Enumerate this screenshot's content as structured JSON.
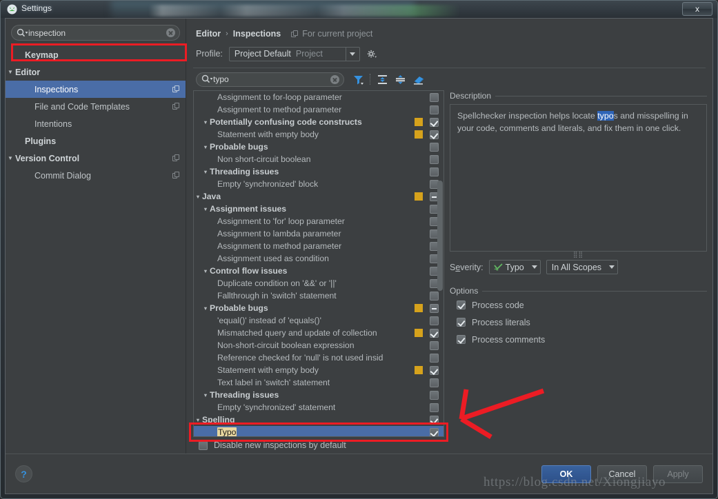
{
  "window": {
    "title": "Settings",
    "app_icon": "android-studio-icon",
    "close_label": "x"
  },
  "sidebar": {
    "search": {
      "value": "inspection",
      "icon": "search-icon",
      "clear_icon": "clear-icon"
    },
    "items": [
      {
        "label": "Keymap",
        "indent": 1,
        "bold": true,
        "arrow": "",
        "selected": false,
        "copy_icon": false
      },
      {
        "label": "Editor",
        "indent": 0,
        "bold": true,
        "arrow": "▼",
        "selected": false,
        "copy_icon": false
      },
      {
        "label": "Inspections",
        "indent": 2,
        "bold": false,
        "arrow": "",
        "selected": true,
        "copy_icon": true
      },
      {
        "label": "File and Code Templates",
        "indent": 2,
        "bold": false,
        "arrow": "",
        "selected": false,
        "copy_icon": true
      },
      {
        "label": "Intentions",
        "indent": 2,
        "bold": false,
        "arrow": "",
        "selected": false,
        "copy_icon": false
      },
      {
        "label": "Plugins",
        "indent": 1,
        "bold": true,
        "arrow": "",
        "selected": false,
        "copy_icon": false
      },
      {
        "label": "Version Control",
        "indent": 0,
        "bold": true,
        "arrow": "▼",
        "selected": false,
        "copy_icon": true
      },
      {
        "label": "Commit Dialog",
        "indent": 2,
        "bold": false,
        "arrow": "",
        "selected": false,
        "copy_icon": true
      }
    ]
  },
  "breadcrumb": {
    "root": "Editor",
    "separator": "›",
    "current": "Inspections",
    "note": "For current project",
    "note_icon": "copy-icon"
  },
  "profile": {
    "label": "Profile:",
    "value": "Project Default",
    "scope": "Project",
    "dropdown_icon": "chevron-down-icon",
    "gear_icon": "gear-icon"
  },
  "tree_toolbar": {
    "search": {
      "value": "typo",
      "icon": "search-icon",
      "clear_icon": "clear-icon"
    },
    "icons": [
      "filter-icon",
      "expand-all-icon",
      "collapse-all-icon",
      "reset-icon"
    ]
  },
  "tree": [
    {
      "label": "Assignment to for-loop parameter",
      "indent": 2,
      "bold": false,
      "arrow": "",
      "swatch": false,
      "check": "off"
    },
    {
      "label": "Assignment to method parameter",
      "indent": 2,
      "bold": false,
      "arrow": "",
      "swatch": false,
      "check": "off"
    },
    {
      "label": "Potentially confusing code constructs",
      "indent": 1,
      "bold": true,
      "arrow": "▼",
      "swatch": true,
      "check": "on"
    },
    {
      "label": "Statement with empty body",
      "indent": 2,
      "bold": false,
      "arrow": "",
      "swatch": true,
      "check": "on"
    },
    {
      "label": "Probable bugs",
      "indent": 1,
      "bold": true,
      "arrow": "▼",
      "swatch": false,
      "check": "off"
    },
    {
      "label": "Non short-circuit boolean",
      "indent": 2,
      "bold": false,
      "arrow": "",
      "swatch": false,
      "check": "off"
    },
    {
      "label": "Threading issues",
      "indent": 1,
      "bold": true,
      "arrow": "▼",
      "swatch": false,
      "check": "off"
    },
    {
      "label": "Empty 'synchronized' block",
      "indent": 2,
      "bold": false,
      "arrow": "",
      "swatch": false,
      "check": "off"
    },
    {
      "label": "Java",
      "indent": 0,
      "bold": true,
      "arrow": "▼",
      "swatch": true,
      "check": "dash"
    },
    {
      "label": "Assignment issues",
      "indent": 1,
      "bold": true,
      "arrow": "▼",
      "swatch": false,
      "check": "off"
    },
    {
      "label": "Assignment to 'for' loop parameter",
      "indent": 2,
      "bold": false,
      "arrow": "",
      "swatch": false,
      "check": "off"
    },
    {
      "label": "Assignment to lambda parameter",
      "indent": 2,
      "bold": false,
      "arrow": "",
      "swatch": false,
      "check": "off"
    },
    {
      "label": "Assignment to method parameter",
      "indent": 2,
      "bold": false,
      "arrow": "",
      "swatch": false,
      "check": "off"
    },
    {
      "label": "Assignment used as condition",
      "indent": 2,
      "bold": false,
      "arrow": "",
      "swatch": false,
      "check": "off"
    },
    {
      "label": "Control flow issues",
      "indent": 1,
      "bold": true,
      "arrow": "▼",
      "swatch": false,
      "check": "off"
    },
    {
      "label": "Duplicate condition on '&&' or '||'",
      "indent": 2,
      "bold": false,
      "arrow": "",
      "swatch": false,
      "check": "off"
    },
    {
      "label": "Fallthrough in 'switch' statement",
      "indent": 2,
      "bold": false,
      "arrow": "",
      "swatch": false,
      "check": "off"
    },
    {
      "label": "Probable bugs",
      "indent": 1,
      "bold": true,
      "arrow": "▼",
      "swatch": true,
      "check": "dash"
    },
    {
      "label": "'equal()' instead of 'equals()'",
      "indent": 2,
      "bold": false,
      "arrow": "",
      "swatch": false,
      "check": "off"
    },
    {
      "label": "Mismatched query and update of collection",
      "indent": 2,
      "bold": false,
      "arrow": "",
      "swatch": true,
      "check": "on"
    },
    {
      "label": "Non-short-circuit boolean expression",
      "indent": 2,
      "bold": false,
      "arrow": "",
      "swatch": false,
      "check": "off"
    },
    {
      "label": "Reference checked for 'null' is not used insid",
      "indent": 2,
      "bold": false,
      "arrow": "",
      "swatch": false,
      "check": "off"
    },
    {
      "label": "Statement with empty body",
      "indent": 2,
      "bold": false,
      "arrow": "",
      "swatch": true,
      "check": "on"
    },
    {
      "label": "Text label in 'switch' statement",
      "indent": 2,
      "bold": false,
      "arrow": "",
      "swatch": false,
      "check": "off"
    },
    {
      "label": "Threading issues",
      "indent": 1,
      "bold": true,
      "arrow": "▼",
      "swatch": false,
      "check": "off"
    },
    {
      "label": "Empty 'synchronized' statement",
      "indent": 2,
      "bold": false,
      "arrow": "",
      "swatch": false,
      "check": "off"
    },
    {
      "label": "Spelling",
      "indent": 0,
      "bold": true,
      "arrow": "▼",
      "swatch": false,
      "check": "on"
    },
    {
      "label": "Typo",
      "indent": 2,
      "bold": false,
      "arrow": "",
      "swatch": false,
      "check": "on",
      "selected": true,
      "highlight": "Typo"
    }
  ],
  "disable_new": {
    "label": "Disable new inspections by default",
    "checked": false
  },
  "description": {
    "title": "Description",
    "text_before": "Spellchecker inspection helps locate ",
    "text_highlight": "typo",
    "text_after": "s and misspelling in your code, comments and literals, and fix them in one click."
  },
  "severity": {
    "label": "Severity:",
    "value": "Typo",
    "icon": "typo-squiggle-icon",
    "scope_value": "In All Scopes",
    "dropdown_icon": "chevron-down-icon"
  },
  "options": {
    "title": "Options",
    "items": [
      {
        "label": "Process code",
        "checked": true
      },
      {
        "label": "Process literals",
        "checked": true
      },
      {
        "label": "Process comments",
        "checked": true
      }
    ]
  },
  "footer": {
    "help_label": "?",
    "ok_label": "OK",
    "cancel_label": "Cancel",
    "apply_label": "Apply"
  },
  "watermark": "https://blog.csdn.net/Xiongjiayo",
  "colors": {
    "selection_blue": "#4a6da7",
    "swatch_yellow": "#d6a21c",
    "annotation_red": "#ec1c24",
    "panel_bg": "#3c3f41",
    "primary_button": "#39629e"
  }
}
